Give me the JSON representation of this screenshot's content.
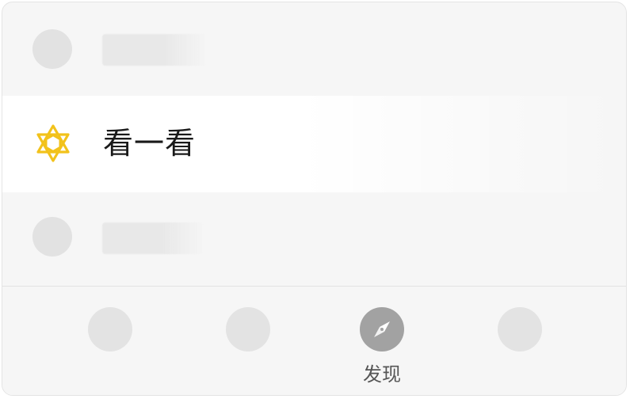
{
  "menu": {
    "highlighted_item": {
      "label": "看一看",
      "icon": "kanyikan-star-icon",
      "icon_color": "#f2c21b"
    }
  },
  "tabbar": {
    "active_tab": {
      "label": "发现",
      "icon": "compass-icon",
      "icon_color": "#a2a2a2"
    }
  },
  "colors": {
    "background": "#f6f6f6",
    "highlight_row": "#ffffff",
    "placeholder": "#e2e2e2",
    "text": "#1a1a1a"
  }
}
